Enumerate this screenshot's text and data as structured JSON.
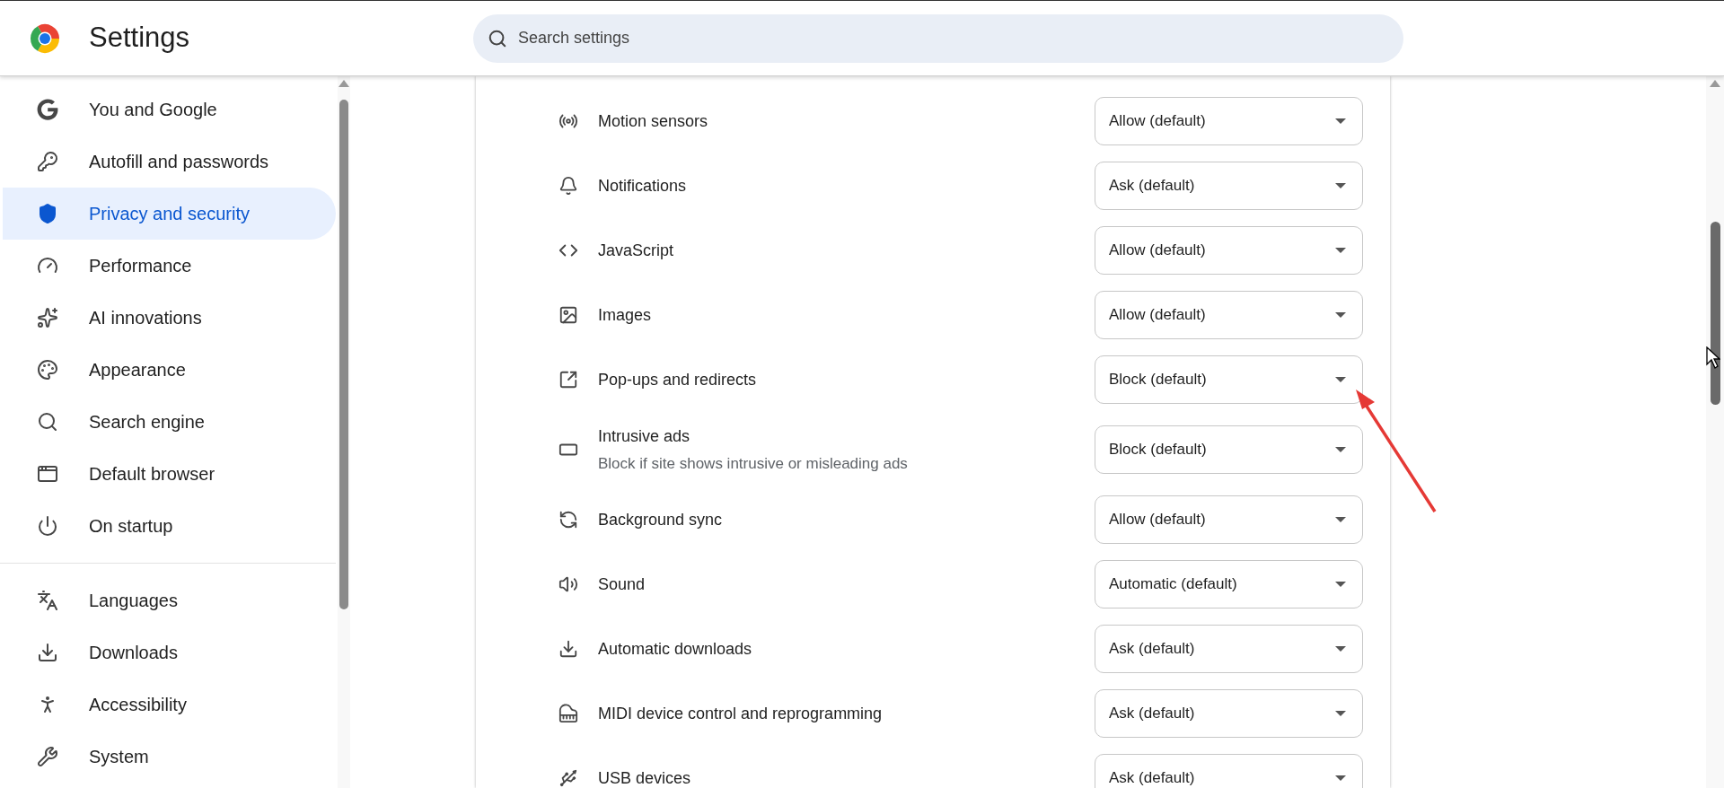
{
  "header": {
    "title": "Settings",
    "search": {
      "placeholder": "Search settings"
    }
  },
  "sidebar": {
    "sections": [
      {
        "items": [
          {
            "label": "You and Google",
            "selected": false
          },
          {
            "label": "Autofill and passwords",
            "selected": false
          },
          {
            "label": "Privacy and security",
            "selected": true
          },
          {
            "label": "Performance",
            "selected": false
          },
          {
            "label": "AI innovations",
            "selected": false
          },
          {
            "label": "Appearance",
            "selected": false
          },
          {
            "label": "Search engine",
            "selected": false
          },
          {
            "label": "Default browser",
            "selected": false
          },
          {
            "label": "On startup",
            "selected": false
          }
        ]
      },
      {
        "items": [
          {
            "label": "Languages",
            "selected": false
          },
          {
            "label": "Downloads",
            "selected": false
          },
          {
            "label": "Accessibility",
            "selected": false
          },
          {
            "label": "System",
            "selected": false
          }
        ]
      }
    ]
  },
  "content": {
    "rows": [
      {
        "label": "Motion sensors",
        "value": "Allow (default)"
      },
      {
        "label": "Notifications",
        "value": "Ask (default)"
      },
      {
        "label": "JavaScript",
        "value": "Allow (default)"
      },
      {
        "label": "Images",
        "value": "Allow (default)"
      },
      {
        "label": "Pop-ups and redirects",
        "value": "Block (default)"
      },
      {
        "label": "Intrusive ads",
        "description": "Block if site shows intrusive or misleading ads",
        "value": "Block (default)"
      },
      {
        "label": "Background sync",
        "value": "Allow (default)"
      },
      {
        "label": "Sound",
        "value": "Automatic (default)"
      },
      {
        "label": "Automatic downloads",
        "value": "Ask (default)"
      },
      {
        "label": "MIDI device control and reprogramming",
        "value": "Ask (default)"
      },
      {
        "label": "USB devices",
        "value": "Ask (default)"
      }
    ]
  }
}
